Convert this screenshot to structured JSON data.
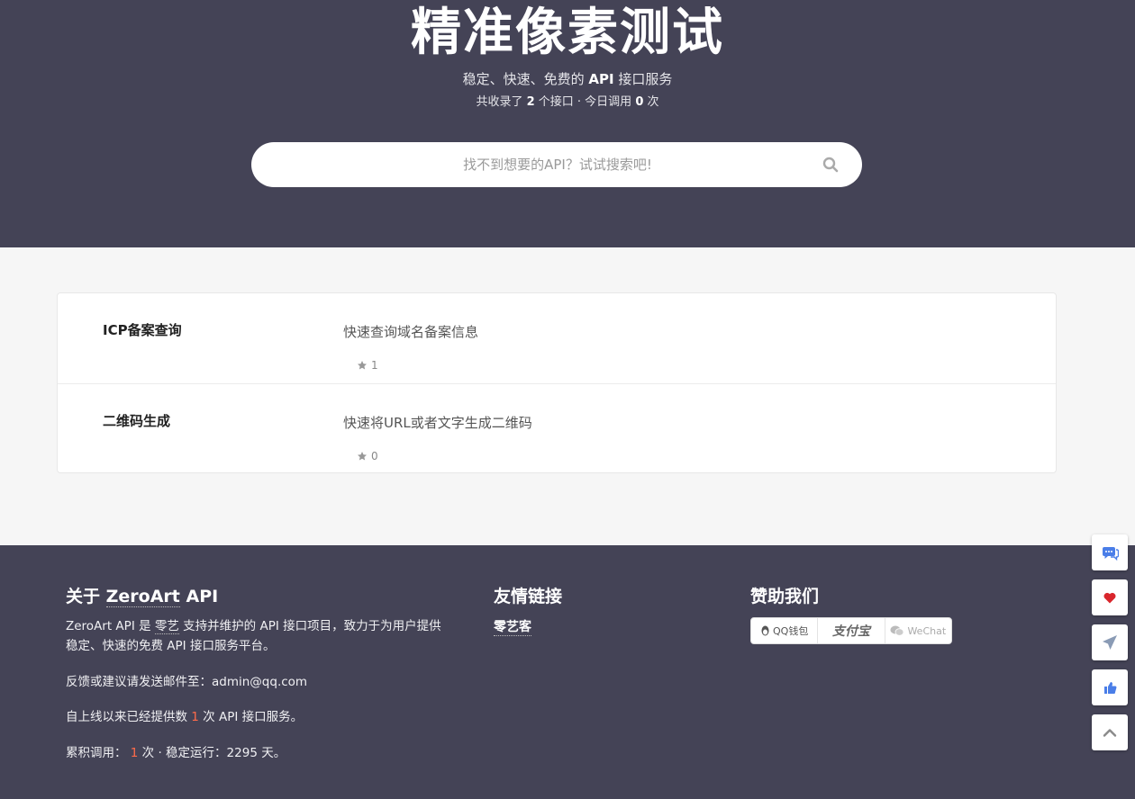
{
  "hero": {
    "title": "精准像素测试",
    "subtitle_pre": "稳定、快速、免费的 ",
    "subtitle_bold": "API",
    "subtitle_post": " 接口服务",
    "stats_pre": "共收录了 ",
    "api_count": "2",
    "stats_mid": " 个接口 · 今日调用 ",
    "today_calls": "0",
    "stats_post": " 次"
  },
  "search": {
    "placeholder": "找不到想要的API？试试搜索吧!",
    "value": ""
  },
  "apis": [
    {
      "name": "ICP备案查询",
      "desc": "快速查询域名备案信息",
      "stars": "1"
    },
    {
      "name": "二维码生成",
      "desc": "快速将URL或者文字生成二维码",
      "stars": "0"
    }
  ],
  "footer": {
    "about_title_pre": "关于 ",
    "about_title_link": "ZeroArt",
    "about_title_post": " API",
    "about_p1_pre": "ZeroArt API 是 ",
    "about_p1_link": "零艺",
    "about_p1_post": " 支持并维护的 API 接口项目，致力于为用户提供",
    "about_p1_line2": "稳定、快速的免费 API 接口服务平台。",
    "feedback": "反馈或建议请发送邮件至：admin@qq.com",
    "served_pre": "自上线以来已经提供数 ",
    "served_count": "1",
    "served_post": " 次 API 接口服务。",
    "total_pre": "累积调用： ",
    "total_count": "1",
    "total_post": " 次 · 稳定运行：2295 天。",
    "links_title": "友情链接",
    "link_1": "零艺客",
    "sponsor_title": "赞助我们",
    "pay_qq": "QQ钱包",
    "pay_ali": "支付宝",
    "pay_wechat": "WeChat"
  },
  "icons": {
    "search": "search-icon",
    "star": "star-icon",
    "chat": "chat-icon",
    "heart": "heart-icon",
    "send": "send-icon",
    "thumb": "thumbs-up-icon",
    "top": "chevron-up-icon"
  },
  "colors": {
    "dark": "#444356",
    "accent_blue": "#4a7ee8",
    "heart_red": "#d9262c",
    "highlight": "#ff6b4a"
  }
}
